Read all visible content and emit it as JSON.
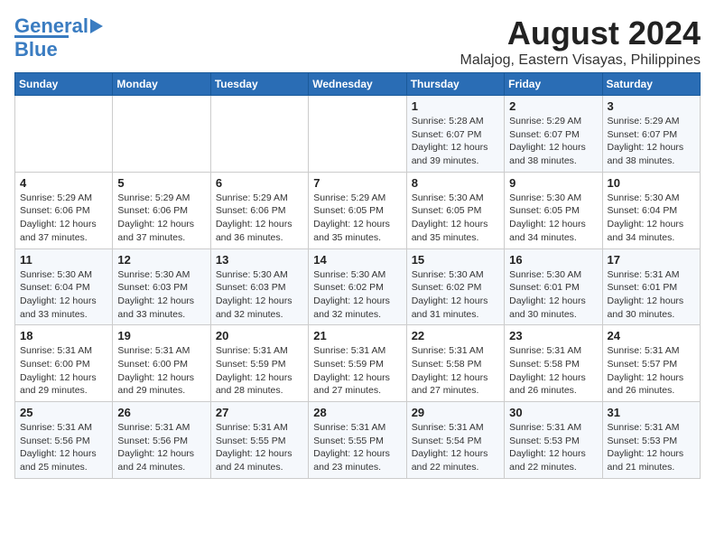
{
  "header": {
    "logo_general": "General",
    "logo_blue": "Blue",
    "title": "August 2024",
    "subtitle": "Malajog, Eastern Visayas, Philippines"
  },
  "weekdays": [
    "Sunday",
    "Monday",
    "Tuesday",
    "Wednesday",
    "Thursday",
    "Friday",
    "Saturday"
  ],
  "weeks": [
    [
      {
        "day": "",
        "sunrise": "",
        "sunset": "",
        "daylight": ""
      },
      {
        "day": "",
        "sunrise": "",
        "sunset": "",
        "daylight": ""
      },
      {
        "day": "",
        "sunrise": "",
        "sunset": "",
        "daylight": ""
      },
      {
        "day": "",
        "sunrise": "",
        "sunset": "",
        "daylight": ""
      },
      {
        "day": "1",
        "sunrise": "5:28 AM",
        "sunset": "6:07 PM",
        "daylight": "12 hours and 39 minutes."
      },
      {
        "day": "2",
        "sunrise": "5:29 AM",
        "sunset": "6:07 PM",
        "daylight": "12 hours and 38 minutes."
      },
      {
        "day": "3",
        "sunrise": "5:29 AM",
        "sunset": "6:07 PM",
        "daylight": "12 hours and 38 minutes."
      }
    ],
    [
      {
        "day": "4",
        "sunrise": "5:29 AM",
        "sunset": "6:06 PM",
        "daylight": "12 hours and 37 minutes."
      },
      {
        "day": "5",
        "sunrise": "5:29 AM",
        "sunset": "6:06 PM",
        "daylight": "12 hours and 37 minutes."
      },
      {
        "day": "6",
        "sunrise": "5:29 AM",
        "sunset": "6:06 PM",
        "daylight": "12 hours and 36 minutes."
      },
      {
        "day": "7",
        "sunrise": "5:29 AM",
        "sunset": "6:05 PM",
        "daylight": "12 hours and 35 minutes."
      },
      {
        "day": "8",
        "sunrise": "5:30 AM",
        "sunset": "6:05 PM",
        "daylight": "12 hours and 35 minutes."
      },
      {
        "day": "9",
        "sunrise": "5:30 AM",
        "sunset": "6:05 PM",
        "daylight": "12 hours and 34 minutes."
      },
      {
        "day": "10",
        "sunrise": "5:30 AM",
        "sunset": "6:04 PM",
        "daylight": "12 hours and 34 minutes."
      }
    ],
    [
      {
        "day": "11",
        "sunrise": "5:30 AM",
        "sunset": "6:04 PM",
        "daylight": "12 hours and 33 minutes."
      },
      {
        "day": "12",
        "sunrise": "5:30 AM",
        "sunset": "6:03 PM",
        "daylight": "12 hours and 33 minutes."
      },
      {
        "day": "13",
        "sunrise": "5:30 AM",
        "sunset": "6:03 PM",
        "daylight": "12 hours and 32 minutes."
      },
      {
        "day": "14",
        "sunrise": "5:30 AM",
        "sunset": "6:02 PM",
        "daylight": "12 hours and 32 minutes."
      },
      {
        "day": "15",
        "sunrise": "5:30 AM",
        "sunset": "6:02 PM",
        "daylight": "12 hours and 31 minutes."
      },
      {
        "day": "16",
        "sunrise": "5:30 AM",
        "sunset": "6:01 PM",
        "daylight": "12 hours and 30 minutes."
      },
      {
        "day": "17",
        "sunrise": "5:31 AM",
        "sunset": "6:01 PM",
        "daylight": "12 hours and 30 minutes."
      }
    ],
    [
      {
        "day": "18",
        "sunrise": "5:31 AM",
        "sunset": "6:00 PM",
        "daylight": "12 hours and 29 minutes."
      },
      {
        "day": "19",
        "sunrise": "5:31 AM",
        "sunset": "6:00 PM",
        "daylight": "12 hours and 29 minutes."
      },
      {
        "day": "20",
        "sunrise": "5:31 AM",
        "sunset": "5:59 PM",
        "daylight": "12 hours and 28 minutes."
      },
      {
        "day": "21",
        "sunrise": "5:31 AM",
        "sunset": "5:59 PM",
        "daylight": "12 hours and 27 minutes."
      },
      {
        "day": "22",
        "sunrise": "5:31 AM",
        "sunset": "5:58 PM",
        "daylight": "12 hours and 27 minutes."
      },
      {
        "day": "23",
        "sunrise": "5:31 AM",
        "sunset": "5:58 PM",
        "daylight": "12 hours and 26 minutes."
      },
      {
        "day": "24",
        "sunrise": "5:31 AM",
        "sunset": "5:57 PM",
        "daylight": "12 hours and 26 minutes."
      }
    ],
    [
      {
        "day": "25",
        "sunrise": "5:31 AM",
        "sunset": "5:56 PM",
        "daylight": "12 hours and 25 minutes."
      },
      {
        "day": "26",
        "sunrise": "5:31 AM",
        "sunset": "5:56 PM",
        "daylight": "12 hours and 24 minutes."
      },
      {
        "day": "27",
        "sunrise": "5:31 AM",
        "sunset": "5:55 PM",
        "daylight": "12 hours and 24 minutes."
      },
      {
        "day": "28",
        "sunrise": "5:31 AM",
        "sunset": "5:55 PM",
        "daylight": "12 hours and 23 minutes."
      },
      {
        "day": "29",
        "sunrise": "5:31 AM",
        "sunset": "5:54 PM",
        "daylight": "12 hours and 22 minutes."
      },
      {
        "day": "30",
        "sunrise": "5:31 AM",
        "sunset": "5:53 PM",
        "daylight": "12 hours and 22 minutes."
      },
      {
        "day": "31",
        "sunrise": "5:31 AM",
        "sunset": "5:53 PM",
        "daylight": "12 hours and 21 minutes."
      }
    ]
  ]
}
